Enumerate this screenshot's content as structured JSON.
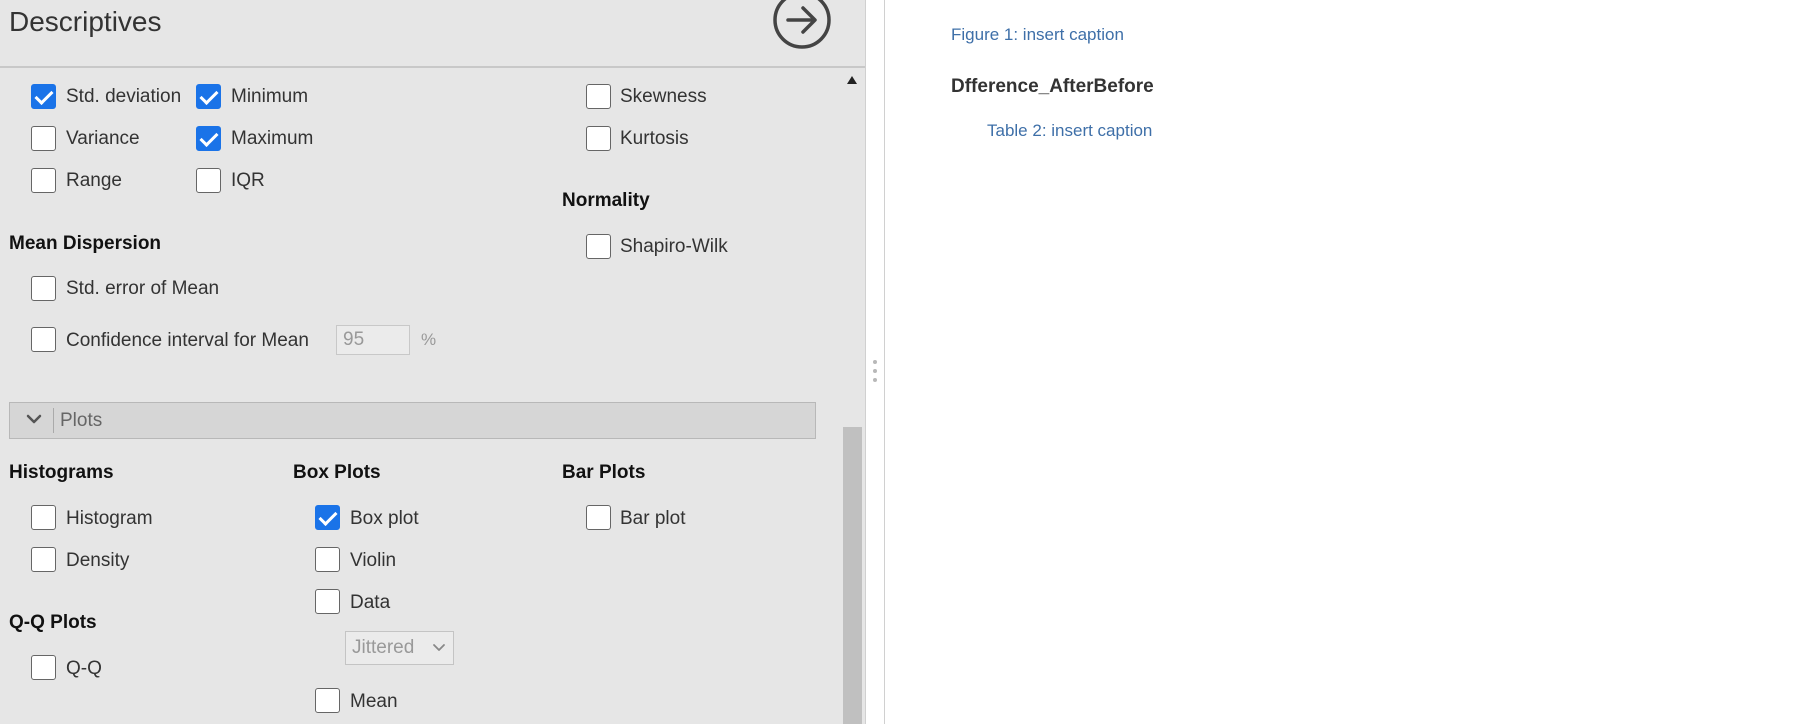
{
  "panel": {
    "title": "Descriptives",
    "run_icon": "arrow-right-circle-icon"
  },
  "statistics": {
    "std_deviation": {
      "label": "Std. deviation",
      "checked": true
    },
    "minimum": {
      "label": "Minimum",
      "checked": true
    },
    "skewness": {
      "label": "Skewness",
      "checked": false
    },
    "variance": {
      "label": "Variance",
      "checked": false
    },
    "maximum": {
      "label": "Maximum",
      "checked": true
    },
    "kurtosis": {
      "label": "Kurtosis",
      "checked": false
    },
    "range": {
      "label": "Range",
      "checked": false
    },
    "iqr": {
      "label": "IQR",
      "checked": false
    }
  },
  "normality": {
    "heading": "Normality",
    "shapiro_wilk": {
      "label": "Shapiro-Wilk",
      "checked": false
    }
  },
  "mean_dispersion": {
    "heading": "Mean Dispersion",
    "std_error": {
      "label": "Std. error of Mean",
      "checked": false
    },
    "ci_mean": {
      "label": "Confidence interval for Mean",
      "checked": false,
      "value": "95",
      "unit": "%"
    }
  },
  "plots_section": {
    "label": "Plots",
    "chevron_icon": "chevron-down-icon"
  },
  "histograms": {
    "heading": "Histograms",
    "histogram": {
      "label": "Histogram",
      "checked": false
    },
    "density": {
      "label": "Density",
      "checked": false
    }
  },
  "box_plots": {
    "heading": "Box Plots",
    "box_plot": {
      "label": "Box plot",
      "checked": true
    },
    "violin": {
      "label": "Violin",
      "checked": false
    },
    "data": {
      "label": "Data",
      "checked": false
    },
    "data_mode": "Jittered",
    "mean": {
      "label": "Mean",
      "checked": false
    }
  },
  "bar_plots": {
    "heading": "Bar Plots",
    "bar_plot": {
      "label": "Bar plot",
      "checked": false
    }
  },
  "qq_plots": {
    "heading": "Q-Q Plots",
    "qq": {
      "label": "Q-Q",
      "checked": false
    }
  },
  "results": {
    "figure_caption": "Figure 1: insert caption",
    "variable_heading": "Dfference_AfterBefore",
    "table_caption": "Table 2: insert caption"
  },
  "colors": {
    "accent": "#1a73e8",
    "panel_bg": "#e6e6e6",
    "caption": "#3e6fa8"
  }
}
